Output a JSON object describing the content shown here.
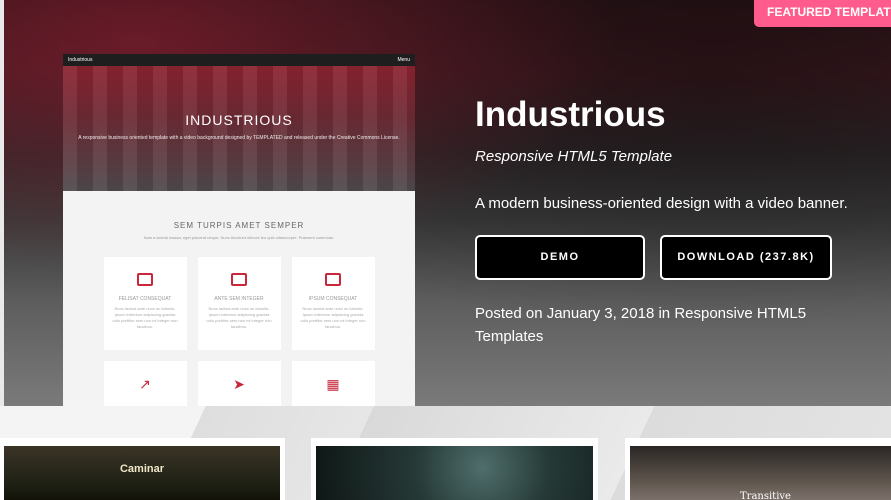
{
  "featured": {
    "badge": "FEATURED TEMPLATE",
    "preview": {
      "brand": "Industrious",
      "menu": "Menu",
      "banner_title": "INDUSTRIOUS",
      "banner_text": "A responsive business oriented template with a video background designed by TEMPLATED and released under the Creative Commons License.",
      "section_heading": "SEM TURPIS AMET SEMPER",
      "section_text": "Nam a lacinia massa, eget placerat neque. Nunc tincidunt ultrices leo quis ullamcorper. Praesent commodo.",
      "cards": [
        {
          "label": "FELISAT CONSEQUAT",
          "text": "Nunc lacinia ante nunc ac lobortis. Ipsum interdum adipiscing gravida odio porttitor sem non mi integer non faucibus."
        },
        {
          "label": "ANTE SEM INTEGER",
          "text": "Nunc lacinia ante nunc ac lobortis. Ipsum interdum adipiscing gravida odio porttitor sem non mi integer non faucibus."
        },
        {
          "label": "IPSUM CONSEQUAT",
          "text": "Nunc lacinia ante nunc ac lobortis. Ipsum interdum adipiscing gravida odio porttitor sem non mi integer non faucibus."
        }
      ]
    },
    "title": "Industrious",
    "subtitle": "Responsive HTML5 Template",
    "description": "A modern business-oriented design with a video banner.",
    "demo_label": "DEMO",
    "download_label": "DOWNLOAD",
    "download_size": "(237.8K)",
    "posted_prefix": "Posted on January 3, 2018 in ",
    "posted_category": "Responsive HTML5 Templates"
  },
  "thumbnails": [
    {
      "name": "Caminar"
    },
    {
      "name": ""
    },
    {
      "name": "Transitive"
    }
  ],
  "colors": {
    "accent": "#ff5c8d",
    "preview_accent": "#c8283c"
  }
}
